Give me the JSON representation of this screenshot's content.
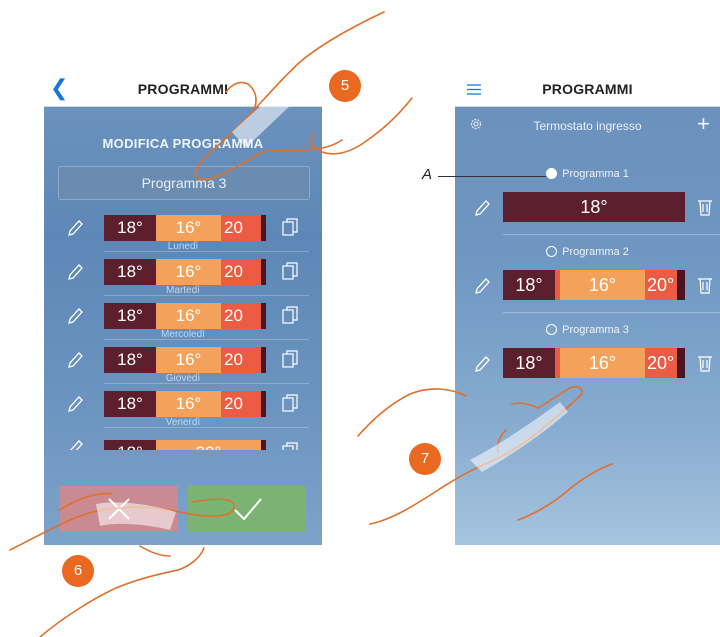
{
  "left_screen": {
    "back_icon": "chevron-left-icon",
    "title": "PROGRAMMI",
    "heading": "MODIFICA PROGRAMMA",
    "program_name": "Programma 3",
    "days": [
      {
        "label": "Lunedì",
        "t1": "18°",
        "t2": "16°",
        "t3": "20"
      },
      {
        "label": "Martedì",
        "t1": "18°",
        "t2": "16°",
        "t3": "20"
      },
      {
        "label": "Mercoledì",
        "t1": "18°",
        "t2": "16°",
        "t3": "20"
      },
      {
        "label": "Giovedì",
        "t1": "18°",
        "t2": "16°",
        "t3": "20"
      },
      {
        "label": "Venerdì",
        "t1": "18°",
        "t2": "16°",
        "t3": "20"
      }
    ],
    "partial_row": {
      "t1": "18°",
      "t2": "20°"
    },
    "cancel_icon": "x-icon",
    "confirm_icon": "checkmark-icon"
  },
  "right_screen": {
    "menu_icon": "hamburger-menu-icon",
    "title": "PROGRAMMI",
    "thermostat_label": "Termostato ingresso",
    "settings_icon": "gear-icon",
    "add_label": "+",
    "programs": [
      {
        "name": "Programma 1",
        "selected": true,
        "t1": "18°"
      },
      {
        "name": "Programma 2",
        "selected": false,
        "t1": "18°",
        "t2": "16°",
        "t3": "20°"
      },
      {
        "name": "Programma 3",
        "selected": false,
        "t1": "18°",
        "t2": "16°",
        "t3": "20°"
      }
    ]
  },
  "annotations": {
    "step_5": "5",
    "step_6": "6",
    "step_7": "7",
    "callout_a": "A"
  },
  "colors": {
    "badge": "#e8691f",
    "temp_dark": "#5c1f2e",
    "temp_orange": "#f4a25b",
    "temp_red": "#ec5b43",
    "confirm_green": "#7cb374",
    "cancel_pink": "#c98a92",
    "accent_blue": "#1676d6"
  }
}
